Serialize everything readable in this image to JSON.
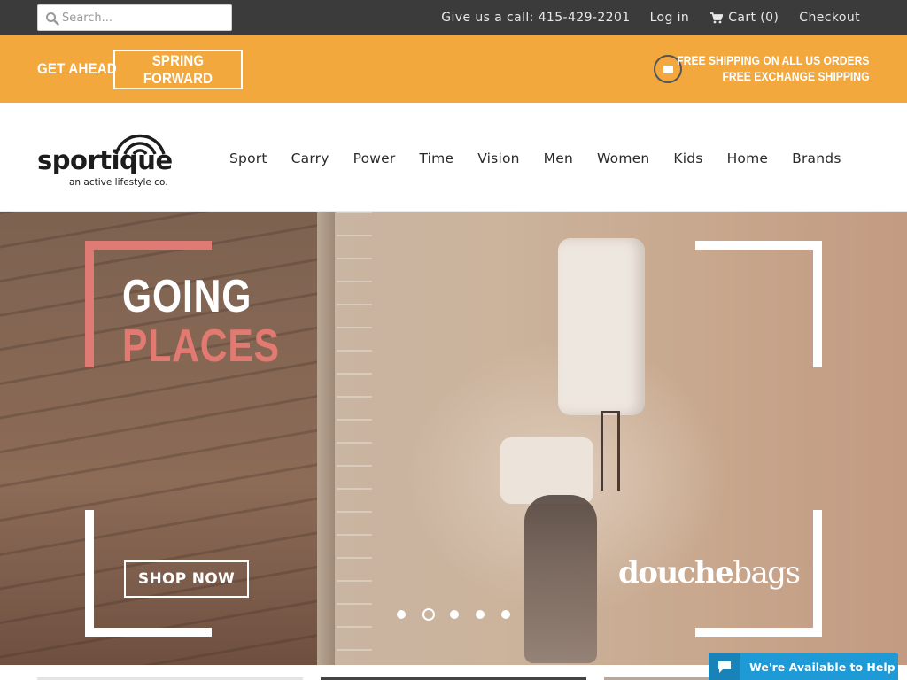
{
  "topbar": {
    "search_placeholder": "Search...",
    "phone": "Give us a call: 415-429-2201",
    "login": "Log in",
    "cart": "Cart (0)",
    "checkout": "Checkout"
  },
  "promo": {
    "get_ahead": "GET AHEAD",
    "spring_forward": "SPRING FORWARD",
    "shipping_line1": "FREE SHIPPING ON ALL US ORDERS",
    "shipping_line2": "FREE EXCHANGE SHIPPING"
  },
  "header": {
    "logo_word": "sportique",
    "logo_tagline": "an active lifestyle co.",
    "nav": [
      "Sport",
      "Carry",
      "Power",
      "Time",
      "Vision",
      "Men",
      "Women",
      "Kids",
      "Home",
      "Brands"
    ]
  },
  "hero": {
    "headline_1": "GOING",
    "headline_2": "PLACES",
    "cta": "SHOP NOW",
    "brand_bold": "douche",
    "brand_light": "bags",
    "slide_count": 5,
    "active_slide": 2
  },
  "chat": {
    "label": "We're Available to Help"
  },
  "colors": {
    "topbar": "#3b3b3b",
    "promo": "#f3a83d",
    "accent_red": "#e27a72",
    "chat": "#1e9ad6"
  },
  "icons": {
    "search": "search-icon",
    "cart": "cart-icon",
    "shipping": "gift-box-icon",
    "chat": "chat-bubble-icon"
  }
}
